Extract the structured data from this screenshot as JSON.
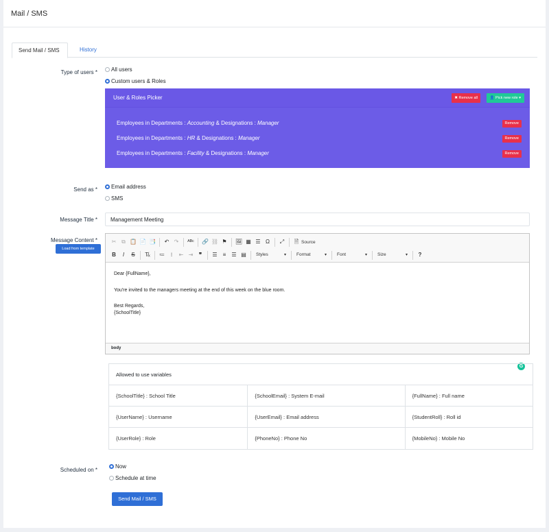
{
  "page": {
    "title": "Mail / SMS"
  },
  "tabs": [
    {
      "label": "Send Mail / SMS"
    },
    {
      "label": "History"
    }
  ],
  "type_of_users": {
    "label": "Type of users *",
    "options": [
      {
        "label": "All users",
        "selected": false
      },
      {
        "label": "Custom users & Roles",
        "selected": true
      }
    ]
  },
  "picker": {
    "title": "User & Roles Picker",
    "remove_all_label": "Remove all",
    "pick_new_role_label": "Pick new role",
    "rows": [
      {
        "prefix": "Employees in Departments : ",
        "department": "Accounting",
        "mid": " & Designations : ",
        "designation": "Manager",
        "remove_label": "Remove"
      },
      {
        "prefix": "Employees in Departments : ",
        "department": "HR",
        "mid": " & Designations : ",
        "designation": "Manager",
        "remove_label": "Remove"
      },
      {
        "prefix": "Employees in Departments : ",
        "department": "Facility",
        "mid": " & Designations : ",
        "designation": "Manager",
        "remove_label": "Remove"
      }
    ],
    "colors": {
      "panel": "#6c5ce7",
      "remove": "#e8304a",
      "pick": "#20c997"
    }
  },
  "send_as": {
    "label": "Send as *",
    "options": [
      {
        "label": "Email address",
        "selected": true
      },
      {
        "label": "SMS",
        "selected": false
      }
    ]
  },
  "message_title": {
    "label": "Message Title *",
    "value": "Management Meeting"
  },
  "message_content": {
    "label": "Message Content *",
    "load_template_label": "Load from template",
    "toolbar": {
      "source_label": "Source",
      "styles_label": "Styles",
      "format_label": "Format",
      "font_label": "Font",
      "size_label": "Size"
    },
    "body_lines": {
      "greeting": "Dear {FullName},",
      "body": "You're invited to the managers meeting at the end of this week on the blue room.",
      "regards": "Best Regards,",
      "signature": "{SchoolTitle}"
    },
    "status_path": "body"
  },
  "variables": {
    "header": "Allowed to use variables",
    "rows": [
      [
        "{SchoolTitle} : School Title",
        "{SchoolEmail} : System E-mail",
        "{FullName} : Full name"
      ],
      [
        "{UserName} : Username",
        "{UserEmail} : Email address",
        "{StudentRoll} : Roll id"
      ],
      [
        "{UserRole} : Role",
        "{PhoneNo} : Phone No",
        "{MobileNo} : Mobile No"
      ]
    ]
  },
  "scheduled_on": {
    "label": "Scheduled on *",
    "options": [
      {
        "label": "Now",
        "selected": true
      },
      {
        "label": "Schedule at time",
        "selected": false
      }
    ]
  },
  "submit_label": "Send Mail / SMS",
  "accent": "#2f6fd6"
}
